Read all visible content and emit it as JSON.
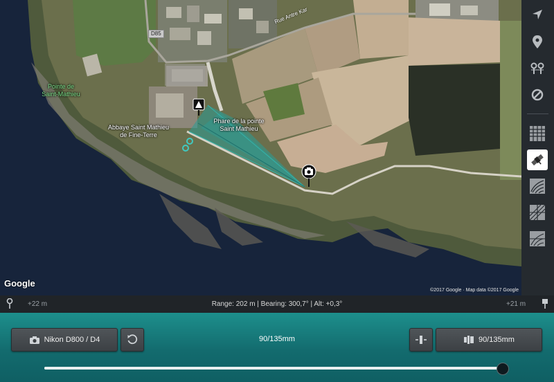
{
  "map": {
    "labels": {
      "pointe": "Pointe de\nSaint-Mathieu",
      "abbaye": "Abbaye Saint Mathieu\nde Fine-Terre",
      "phare": "Phare de la pointe\nSaint Mathieu",
      "road_badge": "D85",
      "road_name": "Rue Antre Kar"
    },
    "google_logo": "Google",
    "credit": "©2017 Google · Map data ©2017 Google",
    "overlay_color": "#2a9d96"
  },
  "toolbar": {
    "items": [
      {
        "name": "location-arrow-icon",
        "active": false
      },
      {
        "name": "map-pin-icon",
        "active": false
      },
      {
        "name": "pin-pair-icon",
        "active": false
      },
      {
        "name": "no-entry-icon",
        "active": false
      },
      {
        "name": "grid-map-icon",
        "active": false
      },
      {
        "name": "satellite-icon",
        "active": true
      },
      {
        "name": "topo-contour-icon",
        "active": false
      },
      {
        "name": "terrain-hatch-icon",
        "active": false
      },
      {
        "name": "hybrid-terrain-icon",
        "active": false
      }
    ]
  },
  "infobar": {
    "alt_left": "+22 m",
    "alt_right": "+21 m",
    "summary": "Range: 202 m | Bearing: 300,7° | Alt: +0,3°"
  },
  "panel": {
    "camera_label": "Nikon D800 / D4",
    "focal_display": "90/135mm",
    "lens_label": "90/135mm",
    "slider_value": 0.99,
    "accent_color": "#1d8f8c"
  }
}
